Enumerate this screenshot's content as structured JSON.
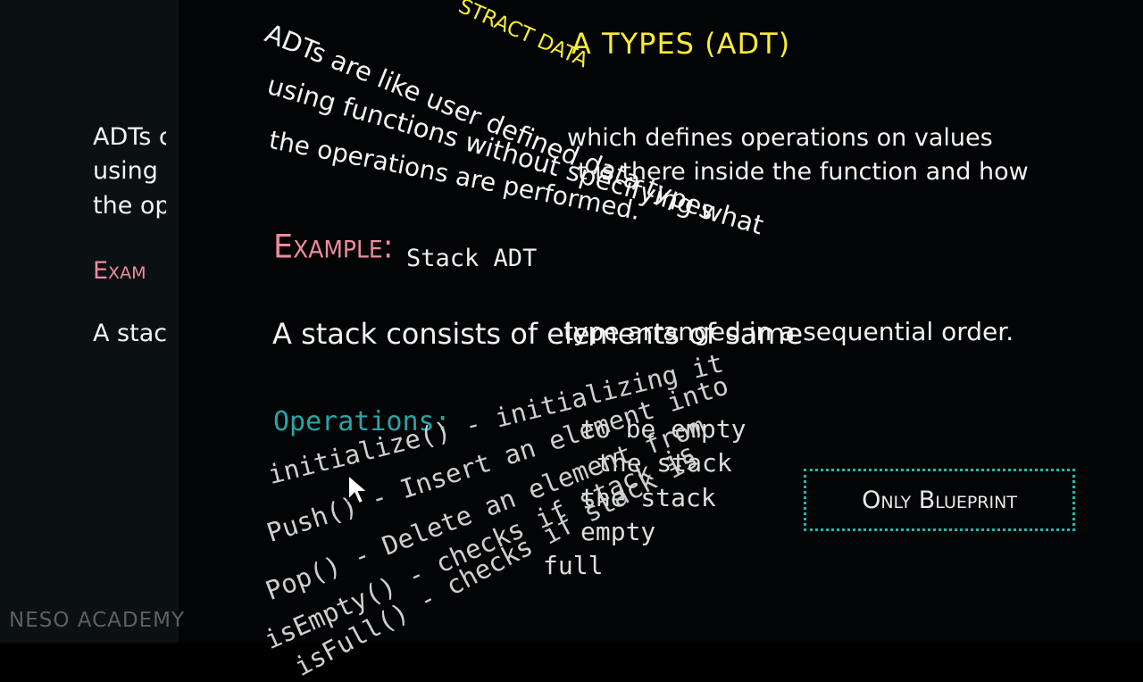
{
  "slide": {
    "title": "A TYPES (ADT)",
    "title_top": "STRACT DATA",
    "left_partial": {
      "line1": "ADTs c",
      "line2": "using",
      "line3": "the op",
      "example": "Exam",
      "line4": "A stac"
    },
    "para": {
      "l1": "ADTs are like user defined data types",
      "l2": "using functions without specifying what",
      "l3": "the operations are performed.",
      "r1": "which defines operations on values",
      "r2": "t is there inside the function and how"
    },
    "example_label": "Example:",
    "example_value": "Stack ADT",
    "stack_left": "A stack consists of elements of same",
    "stack_right": "type arranged in a sequential order.",
    "operations_label": "Operations:",
    "operations": [
      {
        "left": "initialize() - initializing it",
        "right": "to be empty"
      },
      {
        "left": "Push() - Insert an element into",
        "right": "the stack"
      },
      {
        "left": "Pop() - Delete an element from",
        "right": "the stack"
      },
      {
        "left": "isEmpty() - checks if stack is",
        "right": "empty"
      },
      {
        "left": "isFull() - checks if stack is",
        "right": "full"
      }
    ],
    "blueprint": "Only Blueprint"
  },
  "branding": {
    "logo": "NESO ACADEMY"
  },
  "colors": {
    "title": "#f7ec34",
    "example": "#ef8aa0",
    "operations": "#2aa4a8",
    "blueprint_border": "#1bbcaf",
    "logo": "#5f5f5f"
  },
  "icons": {
    "cursor": "arrow-cursor-icon"
  }
}
